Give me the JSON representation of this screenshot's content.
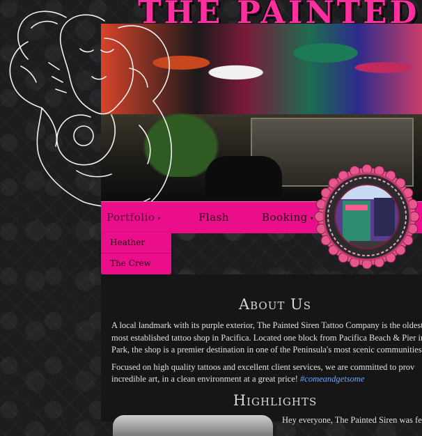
{
  "header": {
    "title": "THE PAINTED"
  },
  "nav": {
    "items": [
      {
        "label": "Portfolio",
        "has_caret": true
      },
      {
        "label": "Flash",
        "has_caret": false
      },
      {
        "label": "Booking",
        "has_caret": true
      }
    ],
    "caret": "▾"
  },
  "dropdown": {
    "items": [
      "Heather",
      "The Crew"
    ]
  },
  "about": {
    "title": "About Us",
    "p1_lines": [
      "A local landmark with its purple exterior, The Painted Siren Tattoo Company is the oldest",
      "most established tattoo shop in Pacifica. Located one block from Pacifica Beach & Pier in S",
      "Park, the shop is a premier destination in one of the Peninsula's most scenic communities."
    ],
    "p2_line1": "Focused on high quality tattoos and excellent client services, we are committed to prov",
    "p2_line2_text": "incredible art, in a clean environment at a great price!",
    "hashtag": "#comeandgetsome"
  },
  "highlights": {
    "title": "Highlights",
    "first_text": "Hey everyone, The Painted Siren was feat"
  },
  "colors": {
    "accent": "#ea0e8a",
    "title": "#ff2fa0",
    "link": "#6fa3ff"
  },
  "icons": {
    "siren": "siren-illustration",
    "badge": "shop-photo-badge"
  }
}
